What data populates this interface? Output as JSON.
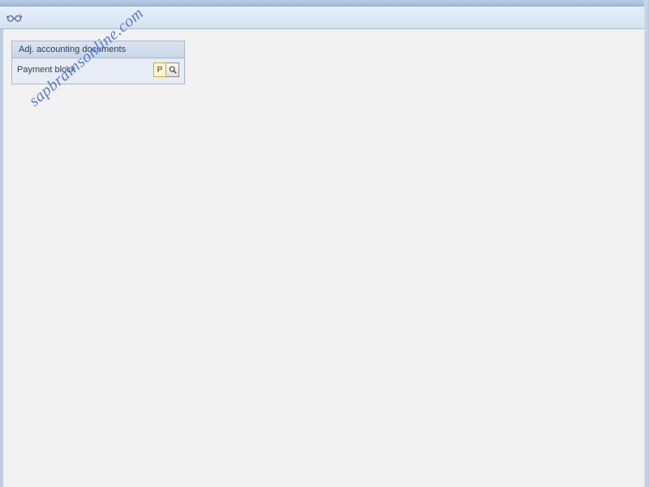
{
  "toolbar": {
    "glasses_icon_title": "Display"
  },
  "panel": {
    "header": "Adj. accounting documents",
    "field_label": "Payment block",
    "field_value": "P",
    "search_title": "Search help"
  },
  "watermark": "sapbrainsonline.com"
}
